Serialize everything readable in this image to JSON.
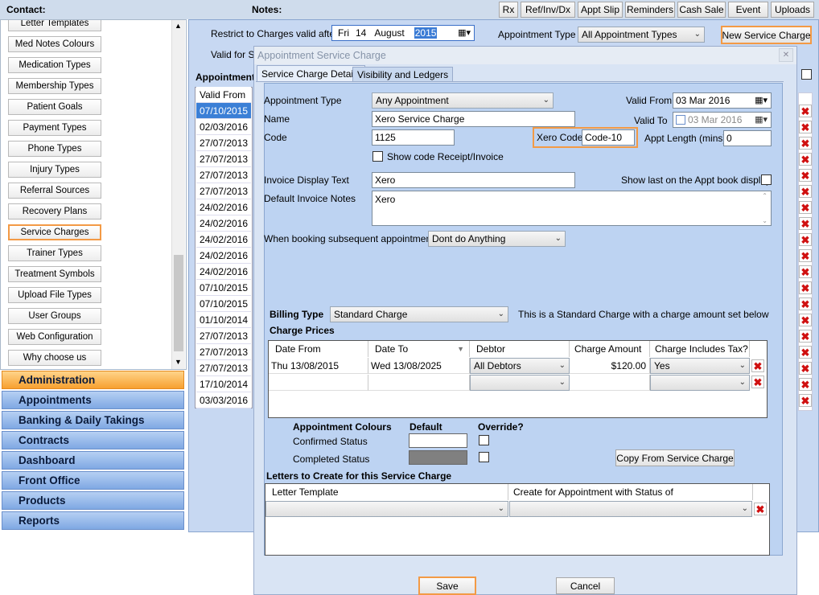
{
  "topbar": {
    "contact_label": "Contact:",
    "notes_label": "Notes:",
    "buttons": [
      "Rx",
      "Ref/Inv/Dx",
      "Appt Slip",
      "Reminders",
      "Cash Sale",
      "Event",
      "Uploads"
    ]
  },
  "left_list": [
    "Letter Templates",
    "Med Notes Colours",
    "Medication Types",
    "Membership Types",
    "Patient Goals",
    "Payment Types",
    "Phone Types",
    "Injury Types",
    "Referral Sources",
    "Recovery Plans",
    "Service Charges",
    "Trainer Types",
    "Treatment Symbols",
    "Upload File Types",
    "User Groups",
    "Web Configuration",
    "Why choose us"
  ],
  "nav": [
    "Administration",
    "Appointments",
    "Banking & Daily Takings",
    "Contracts",
    "Dashboard",
    "Front Office",
    "Products",
    "Reports"
  ],
  "main": {
    "restrict_label": "Restrict to Charges valid after",
    "date_day": "Fri",
    "date_num": "14",
    "date_month": "August",
    "date_year": "2015",
    "appt_type_label": "Appointment Type",
    "appt_type_value": "All Appointment Types",
    "new_service_charge": "New Service Charge",
    "valid_for_label": "Valid for Sit",
    "appointment_label": "Appointment",
    "valid_from_header": "Valid From",
    "valid_from_values": [
      "07/10/2015",
      "02/03/2016",
      "27/07/2013",
      "27/07/2013",
      "27/07/2013",
      "27/07/2013",
      "24/02/2016",
      "24/02/2016",
      "24/02/2016",
      "24/02/2016",
      "24/02/2016",
      "07/10/2015",
      "07/10/2015",
      "01/10/2014",
      "27/07/2013",
      "27/07/2013",
      "27/07/2013",
      "17/10/2014",
      "03/03/2016"
    ]
  },
  "dialog": {
    "title": "Appointment Service Charge",
    "tabs": [
      "Service Charge Details",
      "Visibility and Ledgers"
    ],
    "appt_type_label": "Appointment Type",
    "appt_type_value": "Any Appointment",
    "name_label": "Name",
    "name_value": "Xero Service Charge",
    "code_label": "Code",
    "code_value": "1125",
    "xero_code_label": "Xero Code",
    "xero_code_value": "Code-10",
    "show_code_label": "Show code Receipt/Invoice",
    "valid_from_label": "Valid From",
    "valid_from_value": "03 Mar 2016",
    "valid_to_label": "Valid To",
    "valid_to_value": "03 Mar 2016",
    "appt_length_label": "Appt Length (mins)",
    "appt_length_value": "0",
    "invoice_display_label": "Invoice Display Text",
    "invoice_display_value": "Xero",
    "show_last_label": "Show last on the Appt book display",
    "default_notes_label": "Default Invoice Notes",
    "default_notes_value": "Xero",
    "subsequent_label": "When booking subsequent appointments",
    "subsequent_value": "Dont do Anything",
    "billing_type_label": "Billing Type",
    "billing_type_value": "Standard Charge",
    "billing_desc": "This is a Standard Charge with a charge amount set below",
    "charge_prices_label": "Charge Prices",
    "price_headers": [
      "Date From",
      "Date To",
      "Debtor",
      "Charge Amount",
      "Charge Includes Tax?"
    ],
    "price_row": {
      "date_from": "Thu 13/08/2015",
      "date_to": "Wed 13/08/2025",
      "debtor": "All Debtors",
      "amount": "$120.00",
      "tax": "Yes"
    },
    "appt_colours_label": "Appointment Colours",
    "default_label": "Default",
    "override_label": "Override?",
    "confirmed_label": "Confirmed Status",
    "completed_label": "Completed Status",
    "copy_button": "Copy From Service Charge",
    "letters_label": "Letters to Create for this Service Charge",
    "letter_headers": [
      "Letter Template",
      "Create for Appointment with Status of"
    ],
    "save": "Save",
    "cancel": "Cancel"
  },
  "colors": {
    "accent": "#f39a45",
    "panel": "#c7d8f2",
    "completed_swatch": "#808080",
    "delete_x": "#d01010"
  },
  "icons": [
    "calendar-icon",
    "dropdown-arrow-icon",
    "delete-icon",
    "scroll-up-icon",
    "scroll-down-icon",
    "close-icon"
  ]
}
